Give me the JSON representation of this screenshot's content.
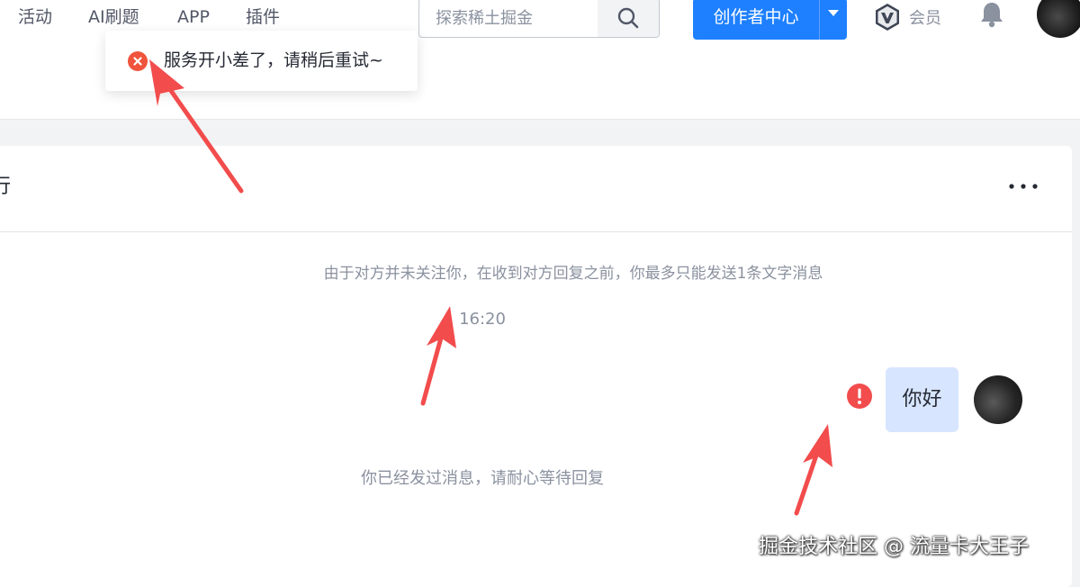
{
  "nav": {
    "items": [
      {
        "label": "活动"
      },
      {
        "label": "AI刷题"
      },
      {
        "label": "APP"
      },
      {
        "label": "插件"
      }
    ]
  },
  "search": {
    "placeholder": "探索稀土掘金",
    "icon": "search-icon"
  },
  "creator": {
    "label": "创作者中心"
  },
  "vip": {
    "label": "会员"
  },
  "toast": {
    "message": "服务开小差了，请稍后重试~",
    "type": "error"
  },
  "chat": {
    "title": "行",
    "notice": "由于对方并未关注你，在收到对方回复之前，你最多只能发送1条文字消息",
    "time": "16:20",
    "message": "你好",
    "wait_notice": "你已经发过消息，请耐心等待回复"
  },
  "watermark": {
    "text": "掘金技术社区 @ 流量卡大王子"
  },
  "colors": {
    "accent": "#1e80ff",
    "error": "#f0543c",
    "bubble": "#d7e5ff",
    "annotation_arrow": "#f24c4c"
  }
}
